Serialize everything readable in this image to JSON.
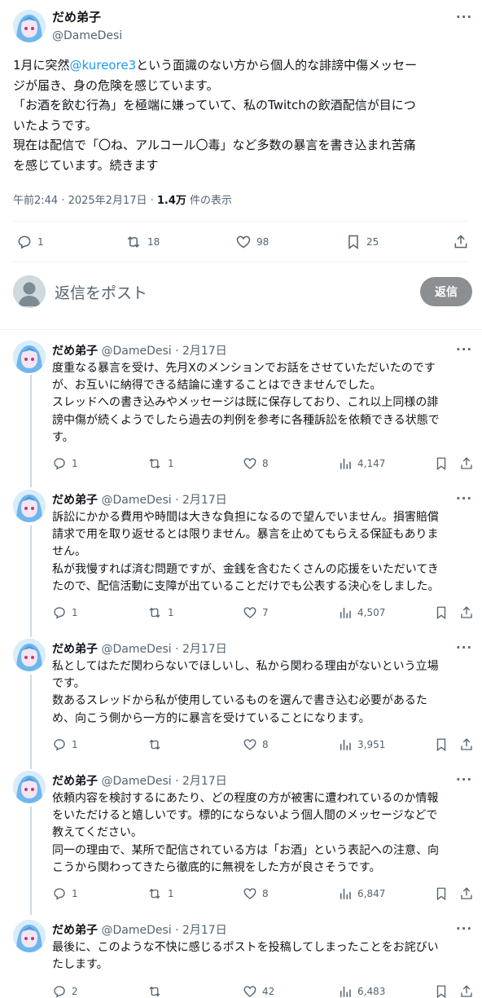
{
  "main_post": {
    "display_name": "だめ弟子",
    "handle": "@DameDesi",
    "more_label": "···",
    "text_lines": [
      [
        "1月に突然",
        "@kureore3",
        "という面識のない方から個人的な誹謗中傷メッセー"
      ],
      [
        "ジが届き、身の危険を感じています。"
      ],
      [
        "「お酒を飲む行為」を極端に嫌っていて、私のTwitchの飲酒配信が目につ"
      ],
      [
        "いたようです。"
      ],
      [
        "現在は配信で「〇ね、アルコール〇毒」など多数の暴言を書き込まれ苦痛"
      ],
      [
        "を感じています。続きます"
      ]
    ],
    "meta": {
      "time": "午前2:44 · 2025年2月17日 · ",
      "views": "1.4万",
      "views_label": " 件の表示"
    },
    "actions": {
      "replies": "1",
      "reposts": "18",
      "likes": "98",
      "bookmarks": "25"
    }
  },
  "composer": {
    "placeholder": "返信をポスト",
    "reply_button": "返信"
  },
  "replies": [
    {
      "name": "だめ弟子",
      "handle": "@DameDesi · 2月17日",
      "lines": [
        "度重なる暴言を受け、先月Xのメンションでお話をさせていただいたのです",
        "が、お互いに納得できる結論に達することはできませんでした。",
        "スレッドへの書き込みやメッセージは既に保存しており、これ以上同様の誹",
        "謗中傷が続くようでしたら過去の判例を参考に各種訴訟を依頼できる状態で",
        "す。"
      ],
      "replies": "1",
      "reposts": "1",
      "likes": "8",
      "views": "4,147"
    },
    {
      "name": "だめ弟子",
      "handle": "@DameDesi · 2月17日",
      "lines": [
        "訴訟にかかる費用や時間は大きな負担になるので望んでいません。損害賠償",
        "請求で用を取り返せるとは限りません。暴言を止めてもらえる保証もありま",
        "せん。",
        "私が我慢すれば済む問題ですが、金銭を含むたくさんの応援をいただいてき",
        "たので、配信活動に支障が出ていることだけでも公表する決心をしました。"
      ],
      "replies": "1",
      "reposts": "1",
      "likes": "7",
      "views": "4,507"
    },
    {
      "name": "だめ弟子",
      "handle": "@DameDesi · 2月17日",
      "lines": [
        "私としてはただ関わらないでほしいし、私から関わる理由がないという立場",
        "です。",
        "数あるスレッドから私が使用しているものを選んで書き込む必要があるた",
        "め、向こう側から一方的に暴言を受けていることになります。"
      ],
      "replies": "1",
      "reposts": "",
      "likes": "8",
      "views": "3,951"
    },
    {
      "name": "だめ弟子",
      "handle": "@DameDesi · 2月17日",
      "lines": [
        "依頼内容を検討するにあたり、どの程度の方が被害に遭われているのか情報",
        "をいただけると嬉しいです。標的にならないよう個人間のメッセージなどで",
        "教えてください。",
        "同一の理由で、某所で配信されている方は「お酒」という表記への注意、向",
        "こうから関わってきたら徹底的に無視をした方が良さそうです。"
      ],
      "replies": "1",
      "reposts": "1",
      "likes": "8",
      "views": "6,847"
    },
    {
      "name": "だめ弟子",
      "handle": "@DameDesi · 2月17日",
      "lines": [
        "最後に、このような不快に感じるポストを投稿してしまったことをお詫びい",
        "たします。"
      ],
      "replies": "2",
      "reposts": "",
      "likes": "42",
      "views": "6,483"
    }
  ],
  "colors": {
    "accent": "#1d9bf0",
    "muted": "#536471",
    "reply_button": "#8b8f92"
  }
}
